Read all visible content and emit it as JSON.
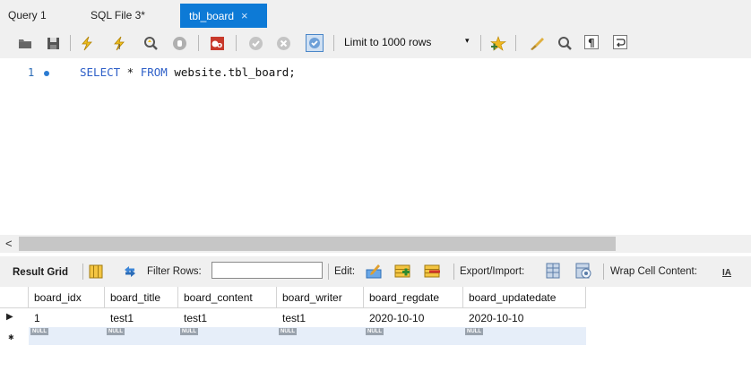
{
  "tabs": [
    {
      "label": "Query 1",
      "active": false
    },
    {
      "label": "SQL File 3*",
      "active": false
    },
    {
      "label": "tbl_board",
      "active": true,
      "close": "×"
    }
  ],
  "toolbar": {
    "icons": [
      "folder-open-icon",
      "save-icon",
      "execute-icon",
      "execute-current-icon",
      "explain-icon",
      "stop-icon",
      "toggle-error-icon",
      "commit-icon",
      "rollback-icon",
      "autocommit-icon"
    ],
    "limit_label": "Limit to 1000 rows",
    "limit_arrow": "▾",
    "right_icons": [
      "bookmark-star-icon",
      "beautify-icon",
      "find-icon",
      "invisible-chars-icon",
      "wrap-icon"
    ]
  },
  "editor": {
    "line_number": "1",
    "sql": {
      "select": "SELECT",
      "star": " * ",
      "from": "FROM",
      "rest": " website.tbl_board;"
    }
  },
  "scroll": {
    "left_arrow": "<"
  },
  "result_toolbar": {
    "result_grid": "Result Grid",
    "filter_rows": "Filter Rows:",
    "filter_value": "",
    "edit": "Edit:",
    "export_import": "Export/Import:",
    "wrap_cell": "Wrap Cell Content:",
    "wrap_icon_text": "IA"
  },
  "grid": {
    "columns": [
      "board_idx",
      "board_title",
      "board_content",
      "board_writer",
      "board_regdate",
      "board_updatedate"
    ],
    "rows": [
      [
        "1",
        "test1",
        "test1",
        "test1",
        "2020-10-10",
        "2020-10-10"
      ]
    ],
    "null_label": "NULL",
    "current_row_marker": "▶",
    "new_row_marker": "✱"
  },
  "colors": {
    "accent": "#0d7ad6",
    "keyword": "#2f60c8",
    "chrome": "#f0f0f0"
  }
}
